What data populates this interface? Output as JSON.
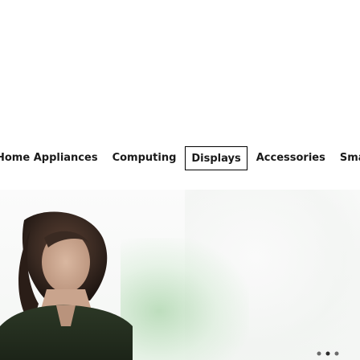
{
  "category_nav": {
    "tabs": [
      {
        "label": "Home Appliances",
        "active": false
      },
      {
        "label": "Computing",
        "active": false
      },
      {
        "label": "Displays",
        "active": true
      },
      {
        "label": "Accessories",
        "active": false
      },
      {
        "label": "SmartThings",
        "active": false
      }
    ]
  },
  "colors": {
    "text": "#1a1a1a",
    "active_border": "#000000",
    "background": "#ffffff"
  }
}
